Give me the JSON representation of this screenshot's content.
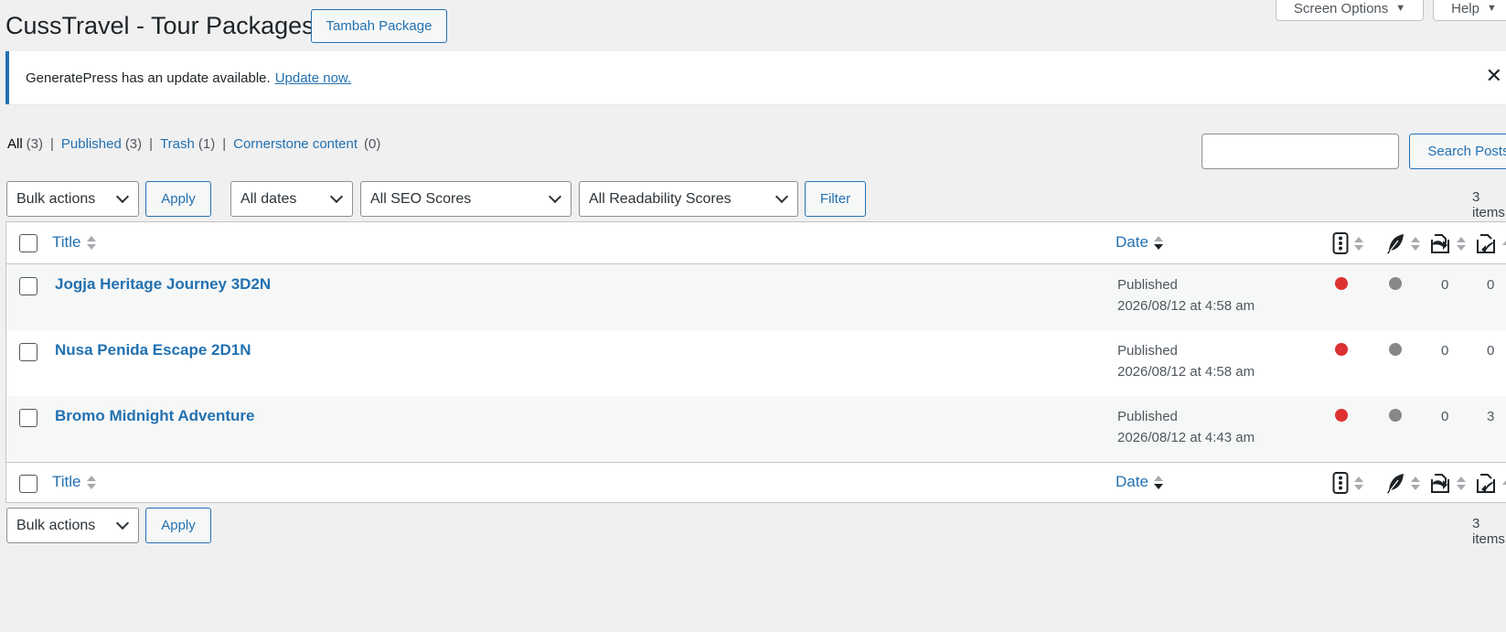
{
  "header": {
    "title": "CussTravel - Tour Packages",
    "add_button": "Tambah Package",
    "screen_options": "Screen Options",
    "help": "Help"
  },
  "notice": {
    "text": "GeneratePress has an update available.",
    "link": "Update now.",
    "close": "✕"
  },
  "views": [
    {
      "label": "All",
      "count": "(3)"
    },
    {
      "label": "Published",
      "count": "(3)"
    },
    {
      "label": "Trash",
      "count": "(1)"
    },
    {
      "label": "Cornerstone content",
      "count": "(0)"
    }
  ],
  "search": {
    "button": "Search Posts",
    "value": ""
  },
  "filters": {
    "bulk_actions": "Bulk actions",
    "apply": "Apply",
    "dates": "All dates",
    "seo": "All SEO Scores",
    "readability": "All Readability Scores",
    "filter": "Filter",
    "items_count": "3 items"
  },
  "columns": {
    "title": "Title",
    "date": "Date"
  },
  "colors": {
    "seo_bad": "#dc3232",
    "readability_na": "#888888",
    "link": "#2271b1"
  },
  "rows": [
    {
      "title": "Jogja Heritage Journey 3D2N",
      "status": "Published",
      "date": "2026/08/12 at 4:58 am",
      "seo": "red",
      "readability": "gray",
      "outgoing": "0",
      "incoming": "0"
    },
    {
      "title": "Nusa Penida Escape 2D1N",
      "status": "Published",
      "date": "2026/08/12 at 4:58 am",
      "seo": "red",
      "readability": "gray",
      "outgoing": "0",
      "incoming": "0"
    },
    {
      "title": "Bromo Midnight Adventure",
      "status": "Published",
      "date": "2026/08/12 at 4:43 am",
      "seo": "red",
      "readability": "gray",
      "outgoing": "0",
      "incoming": "3"
    }
  ]
}
